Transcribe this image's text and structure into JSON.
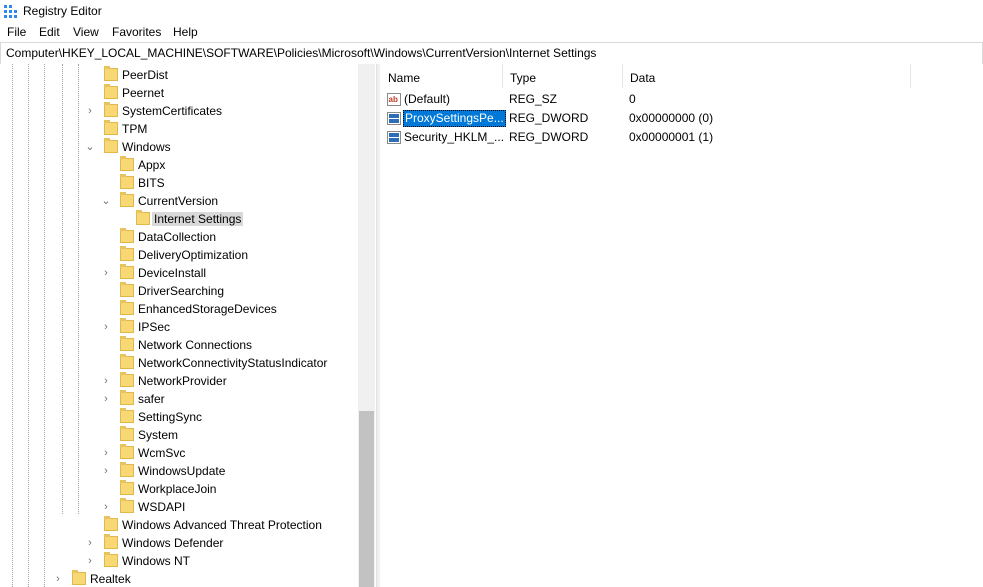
{
  "window": {
    "title": "Registry Editor"
  },
  "menu": [
    "File",
    "Edit",
    "View",
    "Favorites",
    "Help"
  ],
  "address": "Computer\\HKEY_LOCAL_MACHINE\\SOFTWARE\\Policies\\Microsoft\\Windows\\CurrentVersion\\Internet Settings",
  "tree": [
    {
      "label": "PeerDist",
      "expander": "none"
    },
    {
      "label": "Peernet",
      "expander": "none"
    },
    {
      "label": "SystemCertificates",
      "expander": "collapsed"
    },
    {
      "label": "TPM",
      "expander": "none"
    },
    {
      "label": "Windows",
      "expander": "expanded"
    },
    {
      "label": "Appx",
      "expander": "none"
    },
    {
      "label": "BITS",
      "expander": "none"
    },
    {
      "label": "CurrentVersion",
      "expander": "expanded"
    },
    {
      "label": "Internet Settings",
      "expander": "none",
      "selected": true
    },
    {
      "label": "DataCollection",
      "expander": "none"
    },
    {
      "label": "DeliveryOptimization",
      "expander": "none"
    },
    {
      "label": "DeviceInstall",
      "expander": "collapsed"
    },
    {
      "label": "DriverSearching",
      "expander": "none"
    },
    {
      "label": "EnhancedStorageDevices",
      "expander": "none"
    },
    {
      "label": "IPSec",
      "expander": "collapsed"
    },
    {
      "label": "Network Connections",
      "expander": "none"
    },
    {
      "label": "NetworkConnectivityStatusIndicator",
      "expander": "none"
    },
    {
      "label": "NetworkProvider",
      "expander": "collapsed"
    },
    {
      "label": "safer",
      "expander": "collapsed"
    },
    {
      "label": "SettingSync",
      "expander": "none"
    },
    {
      "label": "System",
      "expander": "none"
    },
    {
      "label": "WcmSvc",
      "expander": "collapsed"
    },
    {
      "label": "WindowsUpdate",
      "expander": "collapsed"
    },
    {
      "label": "WorkplaceJoin",
      "expander": "none"
    },
    {
      "label": "WSDAPI",
      "expander": "collapsed"
    },
    {
      "label": "Windows Advanced Threat Protection",
      "expander": "none"
    },
    {
      "label": "Windows Defender",
      "expander": "collapsed"
    },
    {
      "label": "Windows NT",
      "expander": "collapsed"
    },
    {
      "label": "Realtek",
      "expander": "collapsed"
    }
  ],
  "columns": {
    "name": "Name",
    "type": "Type",
    "data": "Data"
  },
  "values": [
    {
      "name": "(Default)",
      "type": "REG_SZ",
      "data": "0",
      "icon": "string-value-icon"
    },
    {
      "name": "ProxySettingsPe...",
      "type": "REG_DWORD",
      "data": "0x00000000 (0)",
      "icon": "binary-value-icon",
      "selected": true
    },
    {
      "name": "Security_HKLM_...",
      "type": "REG_DWORD",
      "data": "0x00000001 (1)",
      "icon": "binary-value-icon"
    }
  ],
  "colors": {
    "selection": "#0078d7",
    "folder": "#f8d775",
    "tree_highlight": "#d9d9d9"
  }
}
